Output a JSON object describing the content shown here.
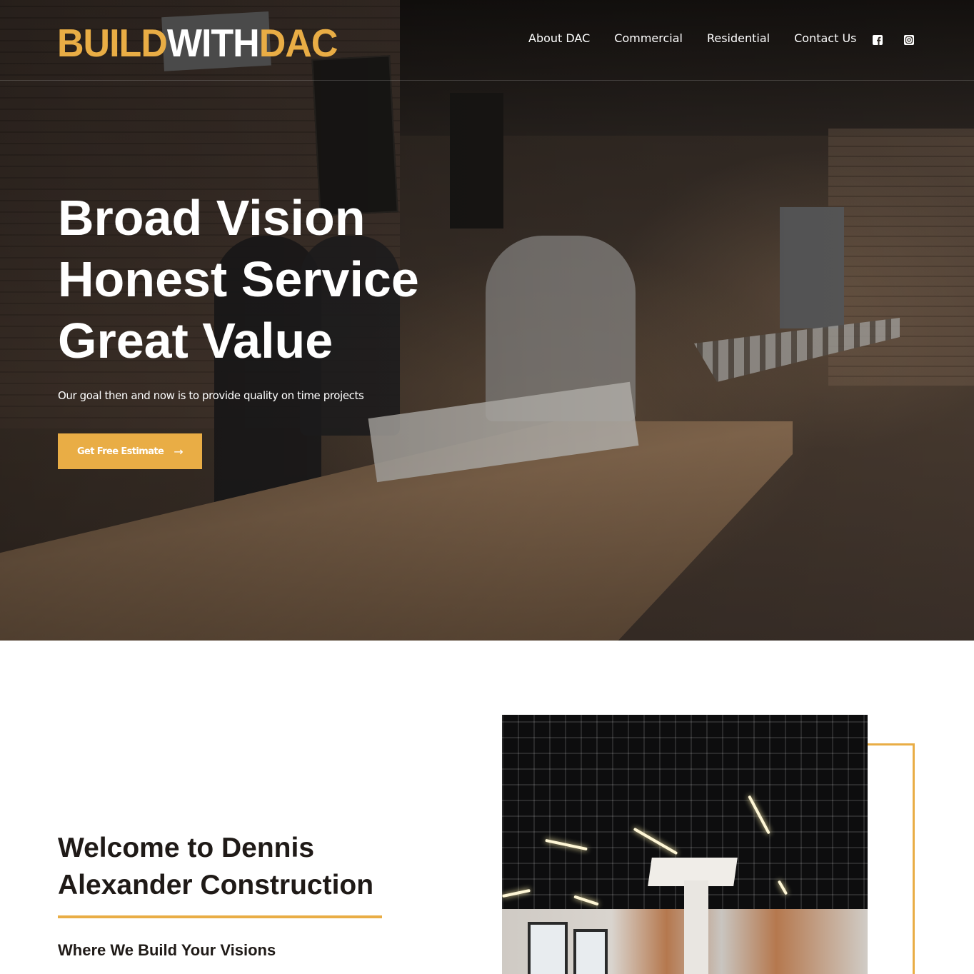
{
  "header": {
    "logo": {
      "part1": "BUILD",
      "part2": "WITH",
      "part3": "DAC"
    },
    "nav": [
      {
        "label": "About DAC"
      },
      {
        "label": "Commercial"
      },
      {
        "label": "Residential"
      },
      {
        "label": "Contact Us"
      }
    ],
    "social": [
      {
        "icon": "facebook-icon"
      },
      {
        "icon": "instagram-icon"
      }
    ]
  },
  "hero": {
    "title_lines": [
      "Broad Vision",
      "Honest Service",
      "Great Value"
    ],
    "subtitle": "Our goal then and now is to provide quality on time projects",
    "cta_label": "Get Free Estimate",
    "cta_icon": "arrow-right-icon"
  },
  "welcome": {
    "title": "Welcome to Dennis Alexander Construction",
    "subtitle": "Where We Build Your Visions"
  },
  "colors": {
    "accent": "#e9ad45",
    "text_dark": "#1f1a17",
    "white": "#ffffff"
  }
}
